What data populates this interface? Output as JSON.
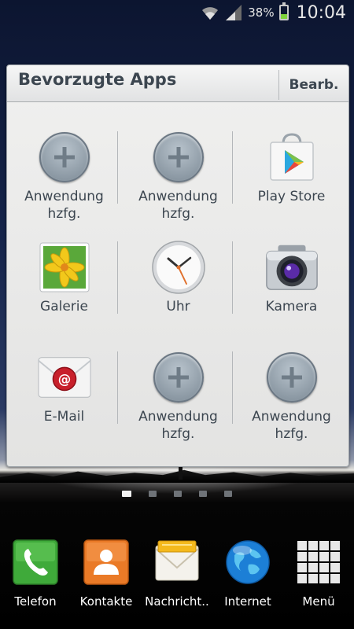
{
  "status_bar": {
    "battery_percent": "38%",
    "time": "10:04",
    "battery_level": 0.38,
    "icons": [
      "wifi-icon",
      "signal-icon",
      "battery-icon"
    ]
  },
  "panel": {
    "title": "Bevorzugte Apps",
    "edit_label": "Bearb.",
    "rows": [
      [
        {
          "label": "Anwendung hzfg.",
          "icon": "add-icon"
        },
        {
          "label": "Anwendung hzfg.",
          "icon": "add-icon"
        },
        {
          "label": "Play Store",
          "icon": "play-store-icon"
        }
      ],
      [
        {
          "label": "Galerie",
          "icon": "gallery-icon"
        },
        {
          "label": "Uhr",
          "icon": "clock-icon"
        },
        {
          "label": "Kamera",
          "icon": "camera-icon"
        }
      ],
      [
        {
          "label": "E-Mail",
          "icon": "email-icon"
        },
        {
          "label": "Anwendung hzfg.",
          "icon": "add-icon"
        },
        {
          "label": "Anwendung hzfg.",
          "icon": "add-icon"
        }
      ]
    ]
  },
  "pager": {
    "pages": 5,
    "active": 0
  },
  "dock": [
    {
      "label": "Telefon",
      "icon": "phone-icon"
    },
    {
      "label": "Kontakte",
      "icon": "contacts-icon"
    },
    {
      "label": "Nachricht..",
      "icon": "messages-icon"
    },
    {
      "label": "Internet",
      "icon": "internet-icon"
    },
    {
      "label": "Menü",
      "icon": "apps-menu-icon"
    }
  ],
  "colors": {
    "panel_text": "#3c4650",
    "battery_fill": "#7ed23b"
  }
}
